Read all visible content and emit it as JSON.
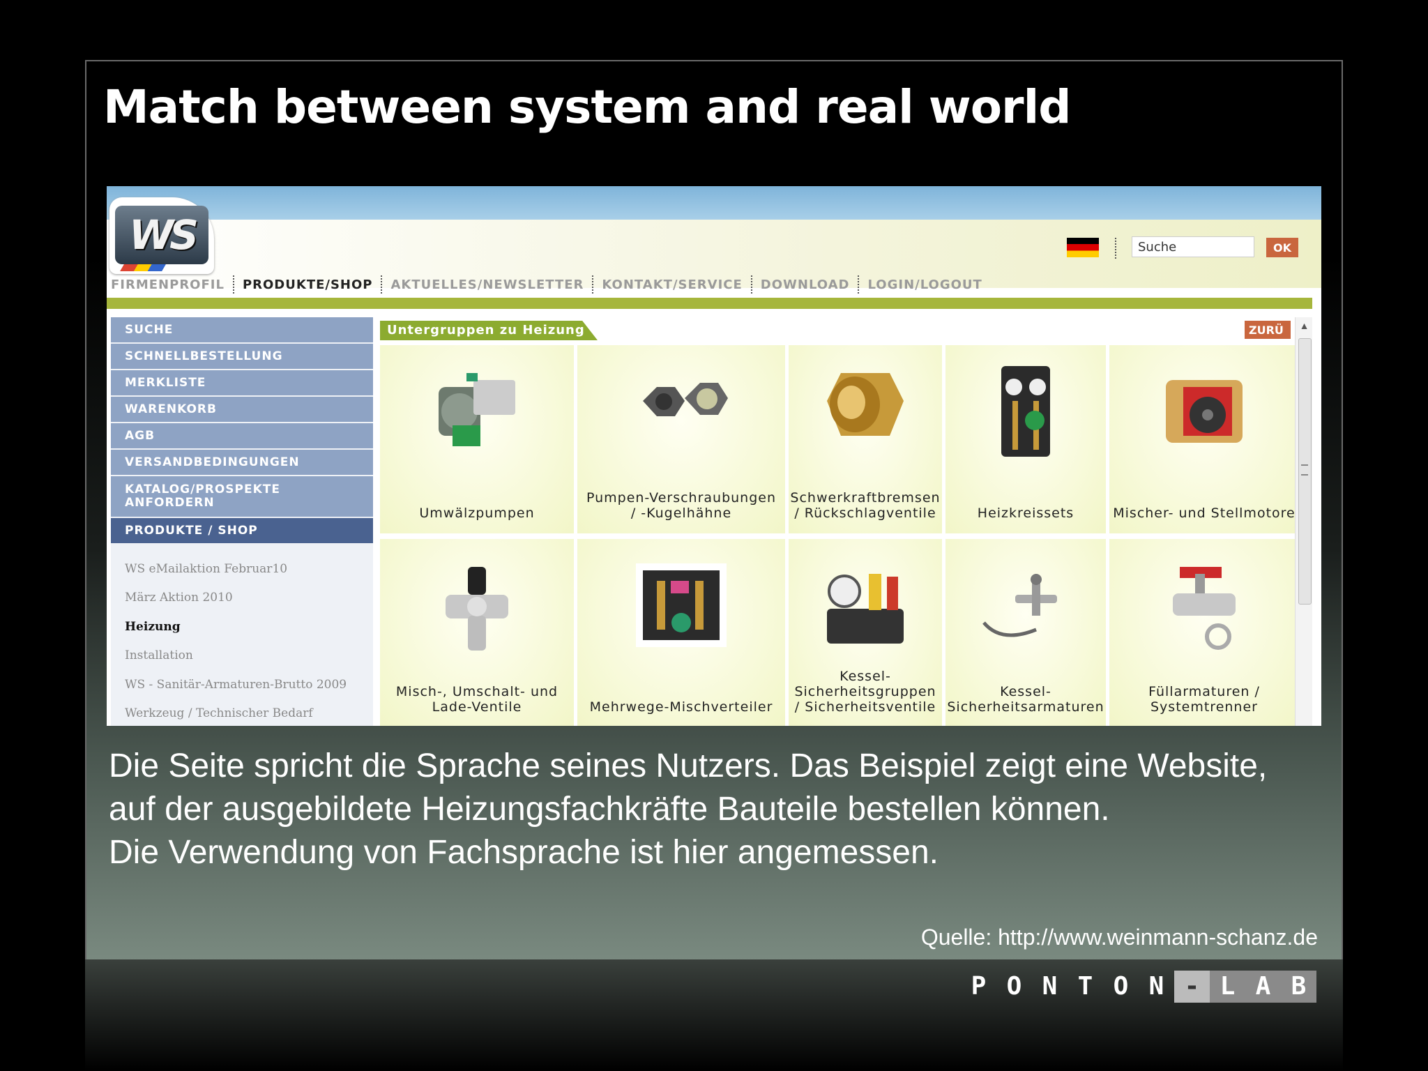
{
  "slide": {
    "title": "Match between system and real world",
    "body": [
      "Die Seite spricht die Sprache seines Nutzers. Das Beispiel zeigt eine Website,",
      "auf der ausgebildete Heizungsfachkräfte Bauteile bestellen können.",
      "Die Verwendung von Fachsprache ist hier angemessen."
    ],
    "source": "Quelle: http://www.weinmann-schanz.de",
    "brand": [
      "P",
      "O",
      "N",
      "T",
      "O",
      "N",
      "-",
      "L",
      "A",
      "B"
    ]
  },
  "site": {
    "logo_text": "WS",
    "search": {
      "value": "Suche",
      "button": "OK"
    },
    "nav": [
      "FIRMENPROFIL",
      "PRODUKTE/SHOP",
      "AKTUELLES/NEWSLETTER",
      "KONTAKT/SERVICE",
      "DOWNLOAD",
      "LOGIN/LOGOUT"
    ],
    "nav_active": "PRODUKTE/SHOP",
    "sidebar": [
      "SUCHE",
      "SCHNELLBESTELLUNG",
      "MERKLISTE",
      "WARENKORB",
      "AGB",
      "VERSANDBEDINGUNGEN",
      "KATALOG/PROSPEKTE ANFORDERN",
      "PRODUKTE / SHOP"
    ],
    "sidebar_active": "PRODUKTE / SHOP",
    "subnav": [
      "WS eMailaktion Februar10",
      "März Aktion 2010",
      "Heizung",
      "Installation",
      "WS - Sanitär-Armaturen-Brutto 2009",
      "Werkzeug / Technischer Bedarf"
    ],
    "subnav_current": "Heizung",
    "group_title": "Untergruppen zu Heizung",
    "back_button": "ZURÜ",
    "products": [
      "Umwälzpumpen",
      "Pumpen-Verschraubungen\n/ -Kugelhähne",
      "Schwerkraftbremsen\n/ Rückschlagventile",
      "Heizkreissets",
      "Mischer- und Stellmotore",
      "Misch-, Umschalt- und\nLade-Ventile",
      "Mehrwege-Mischverteiler",
      "Kessel-\nSicherheitsgruppen\n/ Sicherheitsventile",
      "Kessel-\nSicherheitsarmaturen",
      "Füllarmaturen /\nSystemtrenner"
    ],
    "product_icons": [
      "pump-icon",
      "fitting-icon",
      "check-valve-icon",
      "heating-set-icon",
      "mixer-motor-icon",
      "mixing-valve-icon",
      "manifold-icon",
      "safety-group-icon",
      "boiler-fitting-icon",
      "fill-valve-icon"
    ]
  }
}
